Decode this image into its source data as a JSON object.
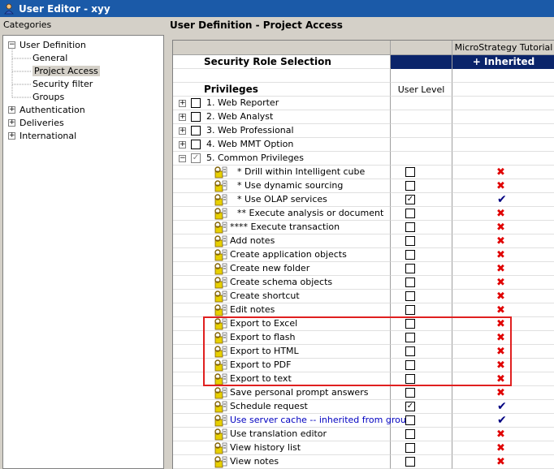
{
  "window": {
    "title": "User Editor - xyy"
  },
  "categories": {
    "header": "Categories",
    "items": [
      {
        "label": "User Definition",
        "level": 0,
        "expander": "minus"
      },
      {
        "label": "General",
        "level": 1
      },
      {
        "label": "Project Access",
        "level": 1,
        "selected": true
      },
      {
        "label": "Security filter",
        "level": 1
      },
      {
        "label": "Groups",
        "level": 1
      },
      {
        "label": "Authentication",
        "level": 0,
        "expander": "plus"
      },
      {
        "label": "Deliveries",
        "level": 0,
        "expander": "plus"
      },
      {
        "label": "International",
        "level": 0,
        "expander": "plus"
      }
    ]
  },
  "section_title": "User Definition - Project Access",
  "grid": {
    "project_header": "MicroStrategy Tutorial",
    "security_role_label": "Security Role Selection",
    "inherited_access_label": "+ Inherited Access",
    "privileges_label": "Privileges",
    "user_level_label": "User Level",
    "groups": [
      {
        "label": "1. Web Reporter",
        "expander": "+"
      },
      {
        "label": "2. Web Analyst",
        "expander": "+"
      },
      {
        "label": "3. Web Professional",
        "expander": "+"
      },
      {
        "label": "4. Web MMT Option",
        "expander": "+"
      },
      {
        "label": "5. Common Privileges",
        "expander": "-"
      }
    ],
    "privileges": [
      {
        "label": "* Drill within Intelligent cube",
        "user": false,
        "inherited": "denied",
        "indent": true
      },
      {
        "label": "* Use dynamic sourcing",
        "user": false,
        "inherited": "denied",
        "indent": true
      },
      {
        "label": "* Use OLAP services",
        "user": true,
        "inherited": "granted",
        "indent": true
      },
      {
        "label": "** Execute analysis or document",
        "user": false,
        "inherited": "denied",
        "indent": true
      },
      {
        "label": "**** Execute transaction",
        "user": false,
        "inherited": "denied",
        "indent": false
      },
      {
        "label": "Add notes",
        "user": false,
        "inherited": "denied"
      },
      {
        "label": "Create application objects",
        "user": false,
        "inherited": "denied"
      },
      {
        "label": "Create new folder",
        "user": false,
        "inherited": "denied"
      },
      {
        "label": "Create schema objects",
        "user": false,
        "inherited": "denied"
      },
      {
        "label": "Create shortcut",
        "user": false,
        "inherited": "denied"
      },
      {
        "label": "Edit notes",
        "user": false,
        "inherited": "denied"
      },
      {
        "label": "Export to Excel",
        "user": false,
        "inherited": "denied"
      },
      {
        "label": "Export to flash",
        "user": false,
        "inherited": "denied"
      },
      {
        "label": "Export to HTML",
        "user": false,
        "inherited": "denied"
      },
      {
        "label": "Export to PDF",
        "user": false,
        "inherited": "denied"
      },
      {
        "label": "Export to text",
        "user": false,
        "inherited": "denied"
      },
      {
        "label": "Save personal prompt answers",
        "user": false,
        "inherited": "denied"
      },
      {
        "label": "Schedule request",
        "user": true,
        "inherited": "granted"
      },
      {
        "label": "Use server cache -- inherited from grou...",
        "user": false,
        "inherited": "granted",
        "link": true
      },
      {
        "label": "Use translation editor",
        "user": false,
        "inherited": "denied"
      },
      {
        "label": "View history list",
        "user": false,
        "inherited": "denied"
      },
      {
        "label": "View notes",
        "user": false,
        "inherited": "denied"
      }
    ]
  },
  "colors": {
    "titlebar": "#1b5aa8",
    "inherited_header_bg": "#0a246a",
    "denied_mark": "#e00000",
    "granted_mark": "#000080",
    "highlight_box": "#e02020",
    "link_text": "#0000c0"
  },
  "icons": {
    "app": "user-editor-icon",
    "privilege": "privilege-key-icon",
    "denied": "x-icon",
    "granted": "check-icon"
  }
}
